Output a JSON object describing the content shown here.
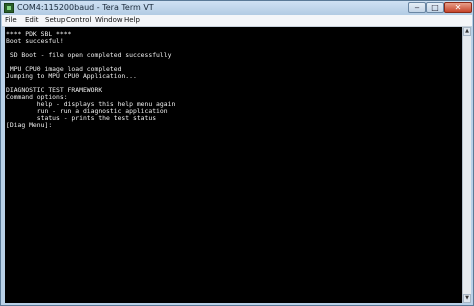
{
  "window": {
    "title": "COM4:115200baud - Tera Term VT",
    "controls": {
      "minimize": "‒",
      "maximize": "□",
      "close": "✕"
    }
  },
  "menu": {
    "items": [
      "File",
      "Edit",
      "Setup",
      "Control",
      "Window",
      "Help"
    ]
  },
  "terminal": {
    "lines": [
      "**** PDK SBL ****",
      "Boot succesful!",
      "",
      " SD Boot - file open completed successfully",
      "",
      " MPU CPU0 image load completed",
      "Jumping to MPU CPU0 Application...",
      "",
      "DIAGNOSTIC TEST FRAMEWORK",
      "Command options:",
      "        help - displays this help menu again",
      "        run - run a diagnostic application",
      "        status - prints the test status",
      "[Diag Menu]:"
    ]
  },
  "scrollbar": {
    "up_icon": "scroll-up-arrow",
    "down_icon": "scroll-down-arrow"
  }
}
